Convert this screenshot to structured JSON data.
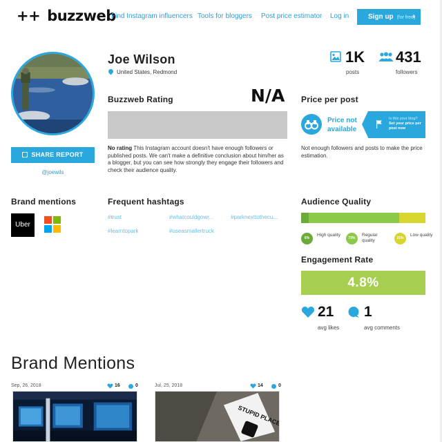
{
  "header": {
    "logo_prefix": "++",
    "logo_text": "buzzweb",
    "nav": [
      {
        "label": "Find Instagram influencers"
      },
      {
        "label": "Tools for bloggers"
      },
      {
        "label": "Post price estimator"
      },
      {
        "label": "Log in"
      }
    ],
    "signup_label": "Sign up",
    "signup_note": "(for free)",
    "signup_icon": "chevron-right-icon"
  },
  "profile": {
    "name": "Joe Wilson",
    "location": "United States, Redmond",
    "handle": "@joewils",
    "share_label": "SHARE REPORT",
    "posts_value": "1K",
    "posts_label": "posts",
    "followers_value": "431",
    "followers_label": "followers"
  },
  "rating": {
    "title": "Buzzweb Rating",
    "value": "N/A",
    "note_bold": "No rating",
    "note_text": " This Instagram account doesn't have enough followers or published posts. We can't make a definitive conclusion about him/her as a blogger, but you can see how strongly they engage their followers and check their audience quality."
  },
  "price": {
    "title": "Price per post",
    "not_available": "Price not available",
    "blog_question": "Is this your blog?",
    "blog_cta": "Set your price per post now",
    "note": "Not enough followers and posts to make the price estimation."
  },
  "brand_mentions": {
    "title": "Brand mentions",
    "brands": [
      "Uber",
      "Microsoft"
    ],
    "uber_text": "Uber"
  },
  "hashtags": {
    "title": "Frequent hashtags",
    "items": [
      "#trust",
      "#whatcouldgowr...",
      "#parknexttothecu...",
      "#learntopark",
      "#useasmallertruck"
    ]
  },
  "audience_quality": {
    "title": "Audience Quality",
    "segments": [
      {
        "label": "High quality",
        "percent": 6,
        "display": "6%",
        "color": "#6aab3a"
      },
      {
        "label": "Regular quality",
        "percent": 73,
        "display": "73%",
        "color": "#8cc94a"
      },
      {
        "label": "Low quality",
        "percent": 21,
        "display": "21%",
        "color": "#d7d62e"
      }
    ]
  },
  "engagement": {
    "title": "Engagement Rate",
    "rate": "4.8%",
    "avg_likes": "21",
    "avg_likes_label": "avg likes",
    "avg_comments": "1",
    "avg_comments_label": "avg comments"
  },
  "posts_section": {
    "heading": "Brand Mentions",
    "posts": [
      {
        "date": "Sep, 26, 2018",
        "likes": "16",
        "comments": "0"
      },
      {
        "date": "Jul, 25, 2018",
        "likes": "14",
        "comments": "0"
      }
    ],
    "sign_text": "STUPID PLACE TO CATCH AN UBER!"
  },
  "colors": {
    "accent": "#2aa8dd",
    "engagement": "#a6cf52"
  }
}
